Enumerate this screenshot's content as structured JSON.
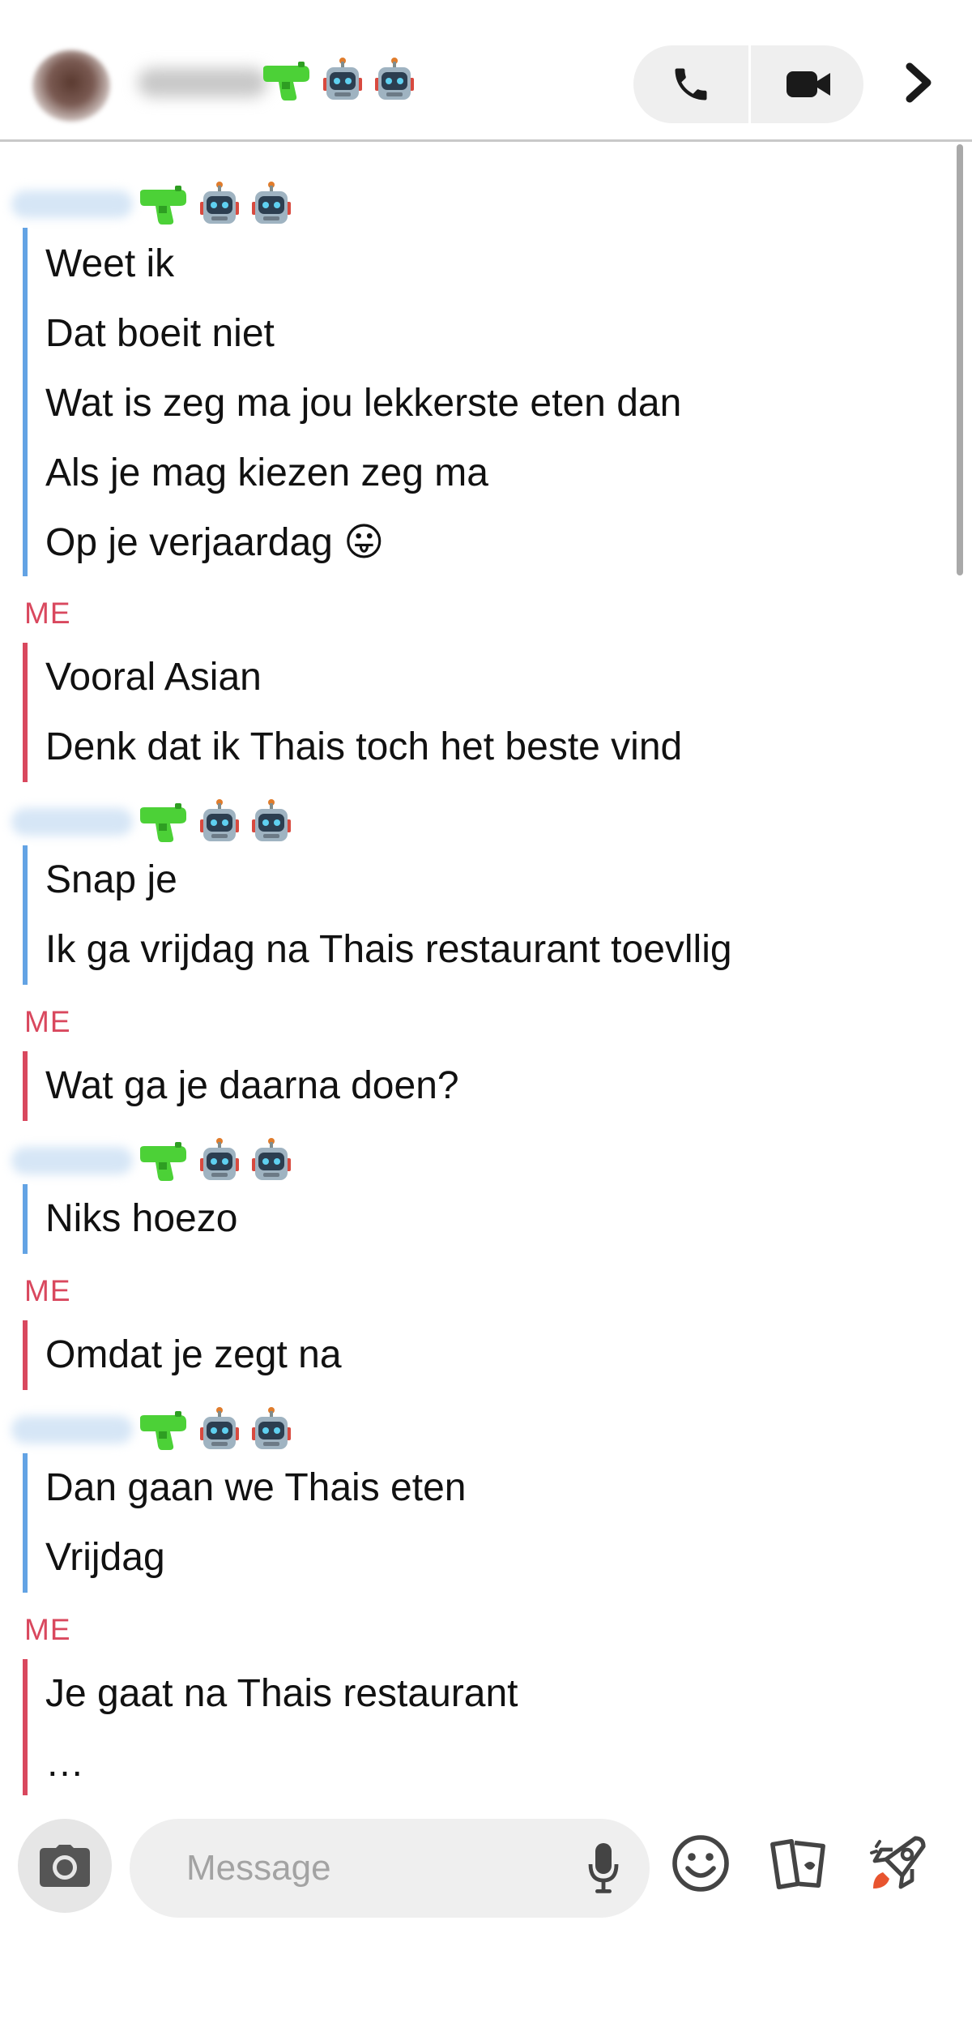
{
  "header": {
    "contact_emojis": [
      "green-water-pistol",
      "robot",
      "robot"
    ],
    "call_button": "phone-icon",
    "video_button": "video-camera-icon",
    "more_button": "chevron-right-icon"
  },
  "chat": {
    "me_label": "ME",
    "groups": [
      {
        "from": "them",
        "messages": [
          "Weet ik",
          "Dat boeit niet",
          "Wat is zeg ma jou lekkerste eten dan",
          "Als je mag kiezen zeg ma",
          "Op je verjaardag"
        ],
        "trailing_emoji": "😛"
      },
      {
        "from": "me",
        "messages": [
          "Vooral Asian",
          "Denk dat ik Thais toch het beste vind"
        ]
      },
      {
        "from": "them",
        "messages": [
          "Snap je",
          "Ik ga vrijdag na Thais restaurant toevllig"
        ]
      },
      {
        "from": "me",
        "messages": [
          "Wat ga je daarna doen?"
        ]
      },
      {
        "from": "them",
        "messages": [
          "Niks hoezo"
        ]
      },
      {
        "from": "me",
        "messages": [
          "Omdat je zegt na"
        ]
      },
      {
        "from": "them",
        "messages": [
          "Dan gaan we Thais eten",
          "Vrijdag"
        ]
      },
      {
        "from": "me",
        "messages": [
          "Je gaat na Thais restaurant",
          "…"
        ]
      }
    ]
  },
  "composer": {
    "placeholder": "Message",
    "camera": "camera-icon",
    "mic": "microphone-icon",
    "emoji": "smiley-icon",
    "stickers": "sticker-cards-icon",
    "games": "rocket-icon"
  },
  "colors": {
    "them_accent": "#63a3e4",
    "me_accent": "#d9485e",
    "gun": "#4cd137"
  }
}
